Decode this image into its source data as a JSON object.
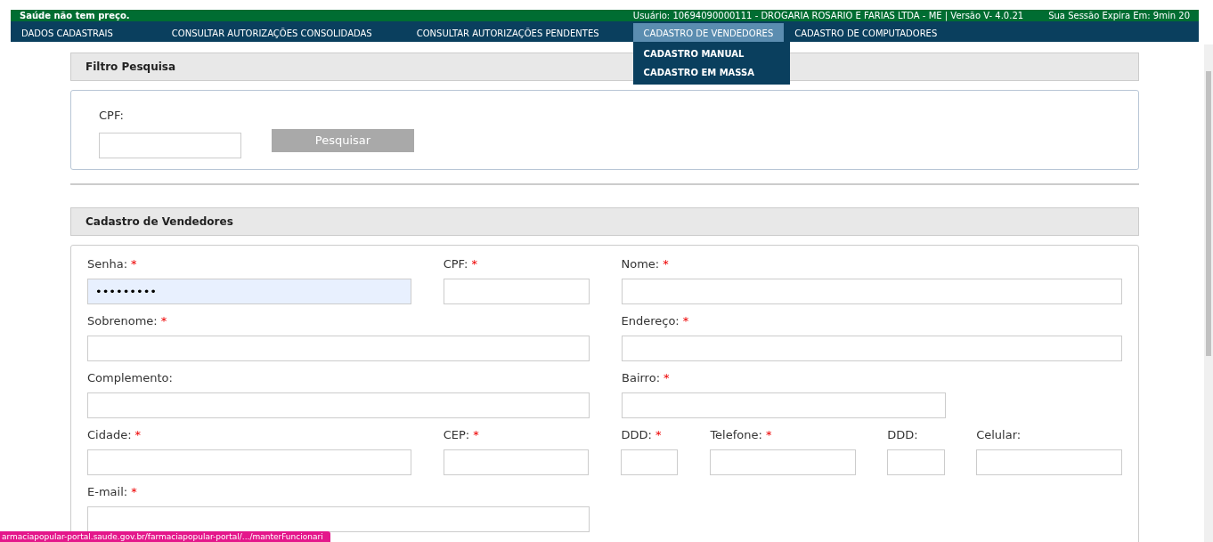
{
  "top_bar": {
    "slogan": "Saúde não tem preço.",
    "user_info": "Usuário: 10694090000111 - DROGARIA ROSARIO E FARIAS LTDA - ME | Versão V- 4.0.21",
    "session": "Sua Sessão Expira Em: 9min 20"
  },
  "nav": [
    {
      "label": "DADOS CADASTRAIS",
      "selected": false
    },
    {
      "label": "CONSULTAR AUTORIZAÇÕES CONSOLIDADAS",
      "selected": false
    },
    {
      "label": "CONSULTAR AUTORIZAÇÕES PENDENTES",
      "selected": false
    },
    {
      "label": "CADASTRO DE VENDEDORES",
      "selected": true,
      "submenu": [
        "CADASTRO MANUAL",
        "CADASTRO EM MASSA"
      ]
    },
    {
      "label": "CADASTRO DE COMPUTADORES",
      "selected": false
    }
  ],
  "filter": {
    "title": "Filtro Pesquisa",
    "label": "CPF:",
    "button": "Pesquisar"
  },
  "form": {
    "title": "Cadastro de Vendedores",
    "required_mark": "*",
    "rows": [
      [
        {
          "label": "Senha:",
          "required": true,
          "value": "•••••••••",
          "autofilled": true
        },
        {
          "label": "CPF:",
          "required": true
        },
        {
          "label": "Nome:",
          "required": true
        }
      ],
      [
        {
          "label": "Sobrenome:",
          "required": true
        },
        {
          "label": "Endereço:",
          "required": true
        }
      ],
      [
        {
          "label": "Complemento:",
          "required": false
        },
        {
          "label": "Bairro:",
          "required": true
        }
      ],
      [
        {
          "label": "Cidade:",
          "required": true
        },
        {
          "label": "CEP:",
          "required": true
        },
        {
          "label": "DDD:",
          "required": true
        },
        {
          "label": "Telefone:",
          "required": true
        },
        {
          "label": "DDD:",
          "required": false
        },
        {
          "label": "Celular:",
          "required": false
        }
      ],
      [
        {
          "label": "E-mail:",
          "required": true
        }
      ]
    ]
  },
  "status_url": "armaciapopular-portal.saude.gov.br/farmaciapopular-portal/.../manterFuncionari"
}
